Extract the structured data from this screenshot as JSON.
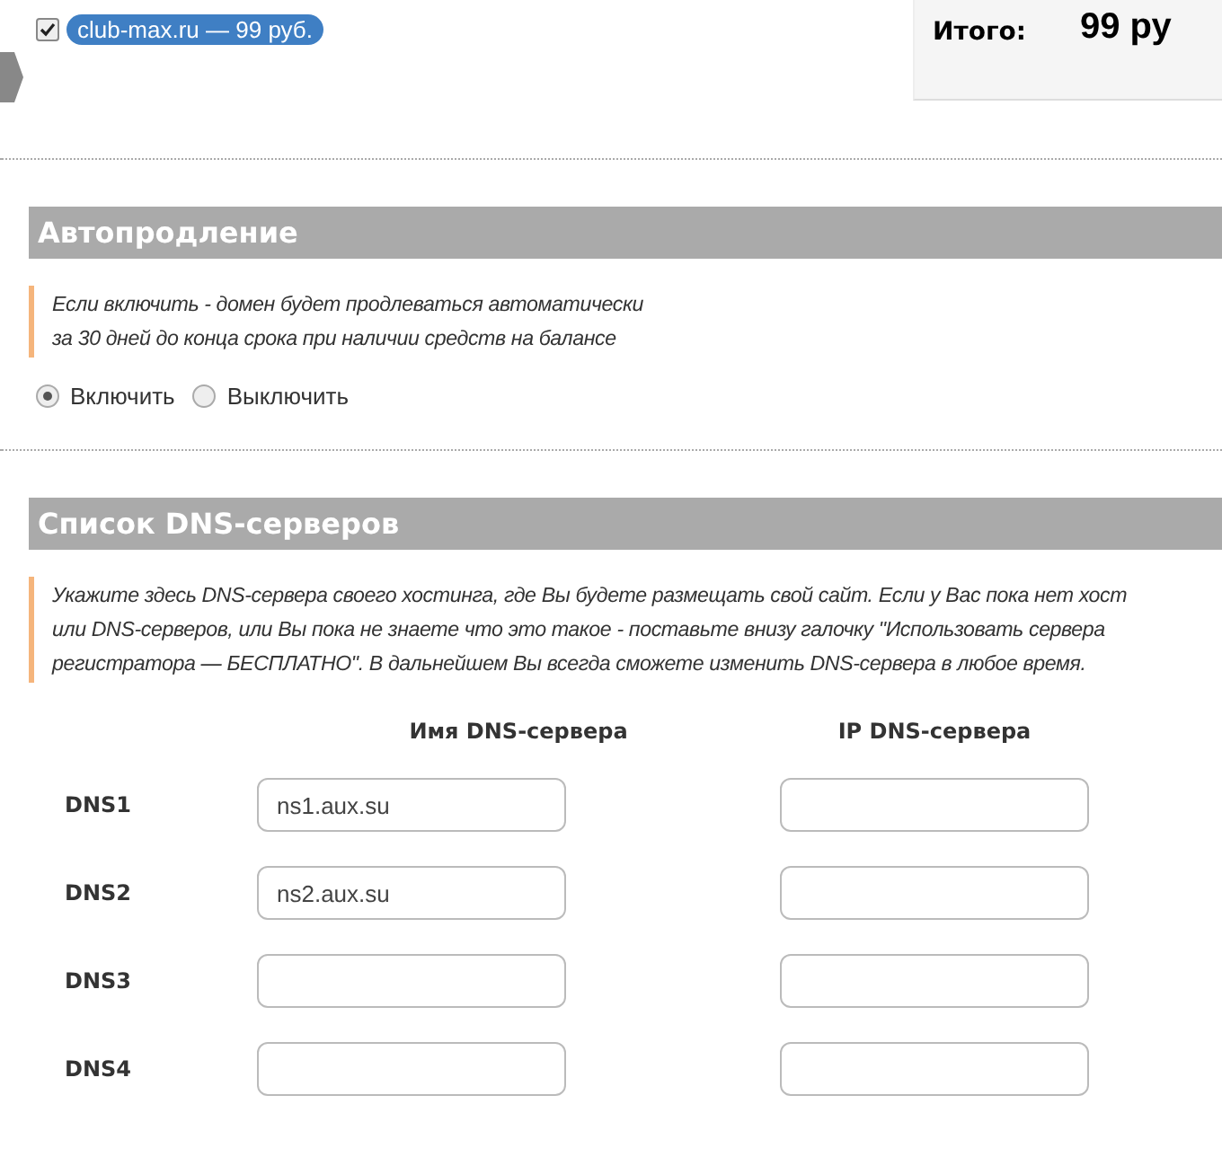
{
  "domain": {
    "checked": true,
    "label": "club-max.ru — 99 руб."
  },
  "total": {
    "label": "Итого:",
    "amount": "99 ру"
  },
  "autorenew": {
    "title": "Автопродление",
    "note_lines": [
      "Если включить - домен будет продлеваться автоматически",
      "за 30 дней до конца срока при наличии средств на балансе"
    ],
    "options": [
      {
        "label": "Включить",
        "selected": true
      },
      {
        "label": "Выключить",
        "selected": false
      }
    ]
  },
  "dns": {
    "title": "Список DNS-серверов",
    "note_lines": [
      "Укажите здесь DNS-сервера своего хостинга, где Вы будете размещать свой сайт. Если у Вас пока нет хост",
      "или DNS-серверов, или Вы пока не знаете что это такое - поставьте внизу галочку \"Использовать сервера",
      "регистратора — БЕСПЛАТНО\". В дальнейшем Вы всегда сможете изменить DNS-сервера в любое время."
    ],
    "columns": [
      "Имя DNS-сервера",
      "IP DNS-сервера"
    ],
    "rows": [
      {
        "label": "DNS1",
        "name": "ns1.aux.su"
      },
      {
        "label": "DNS2",
        "name": "ns2.aux.su"
      },
      {
        "label": "DNS3"
      },
      {
        "label": "DNS4"
      }
    ]
  }
}
